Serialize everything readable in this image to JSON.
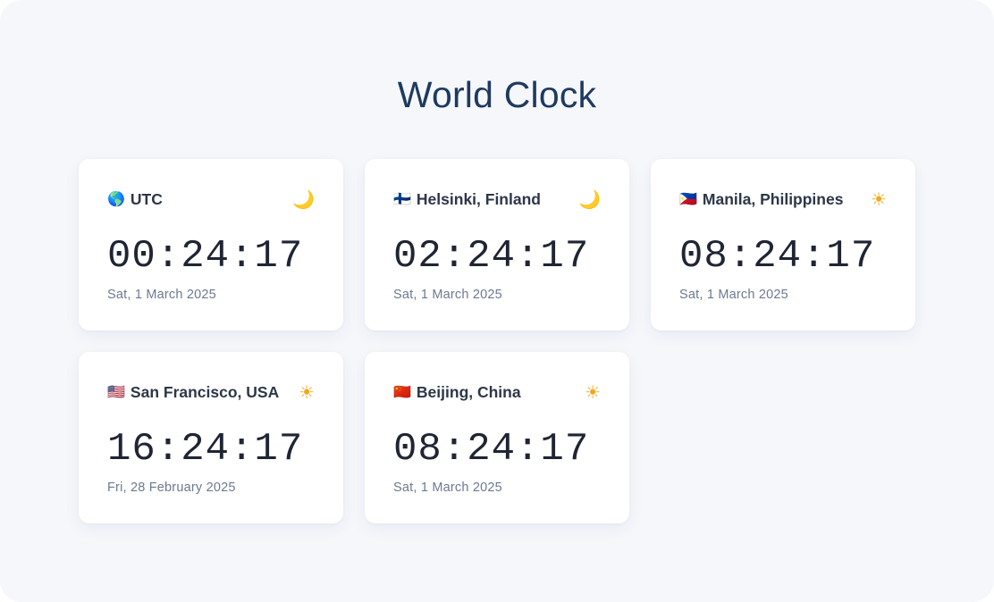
{
  "title": "World Clock",
  "clocks": [
    {
      "flag": "🌎",
      "city": "UTC",
      "time": "00:24:17",
      "date": "Sat, 1 March 2025",
      "period": "moon-icon",
      "period_glyph": "🌙"
    },
    {
      "flag": "🇫🇮",
      "city": "Helsinki, Finland",
      "time": "02:24:17",
      "date": "Sat, 1 March 2025",
      "period": "moon-icon",
      "period_glyph": "🌙"
    },
    {
      "flag": "🇵🇭",
      "city": "Manila, Philippines",
      "time": "08:24:17",
      "date": "Sat, 1 March 2025",
      "period": "sun-icon",
      "period_glyph": "☀"
    },
    {
      "flag": "🇺🇸",
      "city": "San Francisco, USA",
      "time": "16:24:17",
      "date": "Fri, 28 February 2025",
      "period": "sun-icon",
      "period_glyph": "☀"
    },
    {
      "flag": "🇨🇳",
      "city": "Beijing, China",
      "time": "08:24:17",
      "date": "Sat, 1 March 2025",
      "period": "sun-icon",
      "period_glyph": "☀"
    }
  ]
}
